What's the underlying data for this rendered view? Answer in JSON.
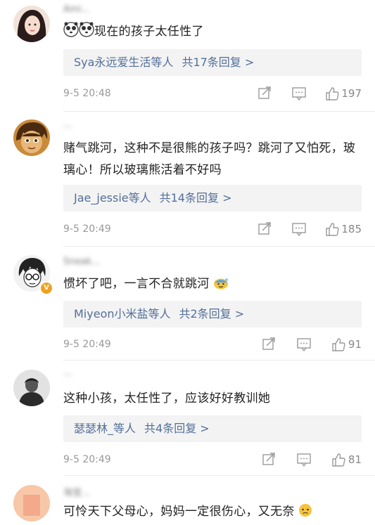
{
  "comments": [
    {
      "username": "Ami...",
      "text": "现在的孩子太任性了",
      "reply_users": "Sya永远爱生活等人",
      "reply_count": "共17条回复 >",
      "time": "9-5 20:48",
      "likes": "197"
    },
    {
      "username": "...",
      "text": "赌气跳河，这种不是很熊的孩子吗？跳河了又怕死，玻璃心！所以玻璃熊活着不好吗",
      "reply_users": "Jae_jessie等人",
      "reply_count": "共14条回复 >",
      "time": "9-5 20:49",
      "likes": "185"
    },
    {
      "username": "Sneak...",
      "text": "惯坏了吧，一言不合就跳河",
      "reply_users": "Miyeon小米盐等人",
      "reply_count": "共2条回复 >",
      "time": "9-5 20:49",
      "likes": "91"
    },
    {
      "username": "...",
      "text": "这种小孩，太任性了，应该好好教训她",
      "reply_users": "瑟瑟林_等人",
      "reply_count": "共4条回复 >",
      "time": "9-5 20:49",
      "likes": "81"
    },
    {
      "username": "淘宝...",
      "text": "可怜天下父母心，妈妈一定很伤心，又无奈"
    }
  ],
  "icons": {
    "share": "share-icon",
    "comment": "comment-icon",
    "like": "thumb-up-icon",
    "verified": "verified-badge-icon"
  },
  "colors": {
    "link": "#536f9a",
    "meta": "#999999",
    "reply_bg": "#f3f3f3",
    "badge": "#f0a01e"
  }
}
